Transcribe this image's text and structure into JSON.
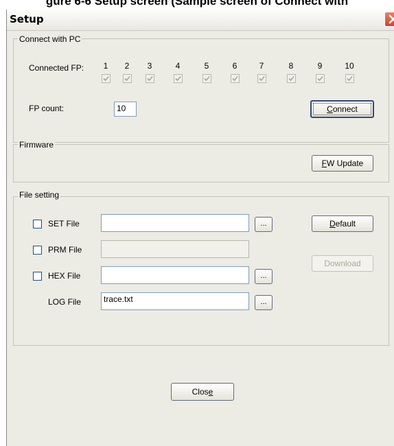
{
  "caption": "gure 6-6 Setup screen (Sample screen of Connect with",
  "window": {
    "title": "Setup"
  },
  "connect": {
    "legend": "Connect with PC",
    "connected_label": "Connected FP:",
    "fp_numbers": [
      "1",
      "2",
      "3",
      "4",
      "5",
      "6",
      "7",
      "8",
      "9",
      "10"
    ],
    "fp_checked": [
      true,
      true,
      true,
      true,
      true,
      true,
      true,
      true,
      true,
      true
    ],
    "count_label": "FP count:",
    "count_value": "10",
    "connect_button": {
      "mnemonic": "C",
      "rest": "onnect"
    }
  },
  "firmware": {
    "legend": "Firmware",
    "update_button": {
      "mnemonic": "F",
      "rest": "W Update"
    }
  },
  "file_setting": {
    "legend": "File setting",
    "set_file": {
      "label": "SET File",
      "value": "",
      "browse": "..."
    },
    "prm_file": {
      "label": "PRM File",
      "value": ""
    },
    "hex_file": {
      "label": "HEX File",
      "value": "",
      "browse": "..."
    },
    "log_file": {
      "label": "LOG File",
      "value": "trace.txt",
      "browse": "..."
    },
    "default_button": {
      "mnemonic": "D",
      "rest": "efault"
    },
    "download_button": "Download"
  },
  "close_button": {
    "before": "Clos",
    "mnemonic": "e"
  }
}
